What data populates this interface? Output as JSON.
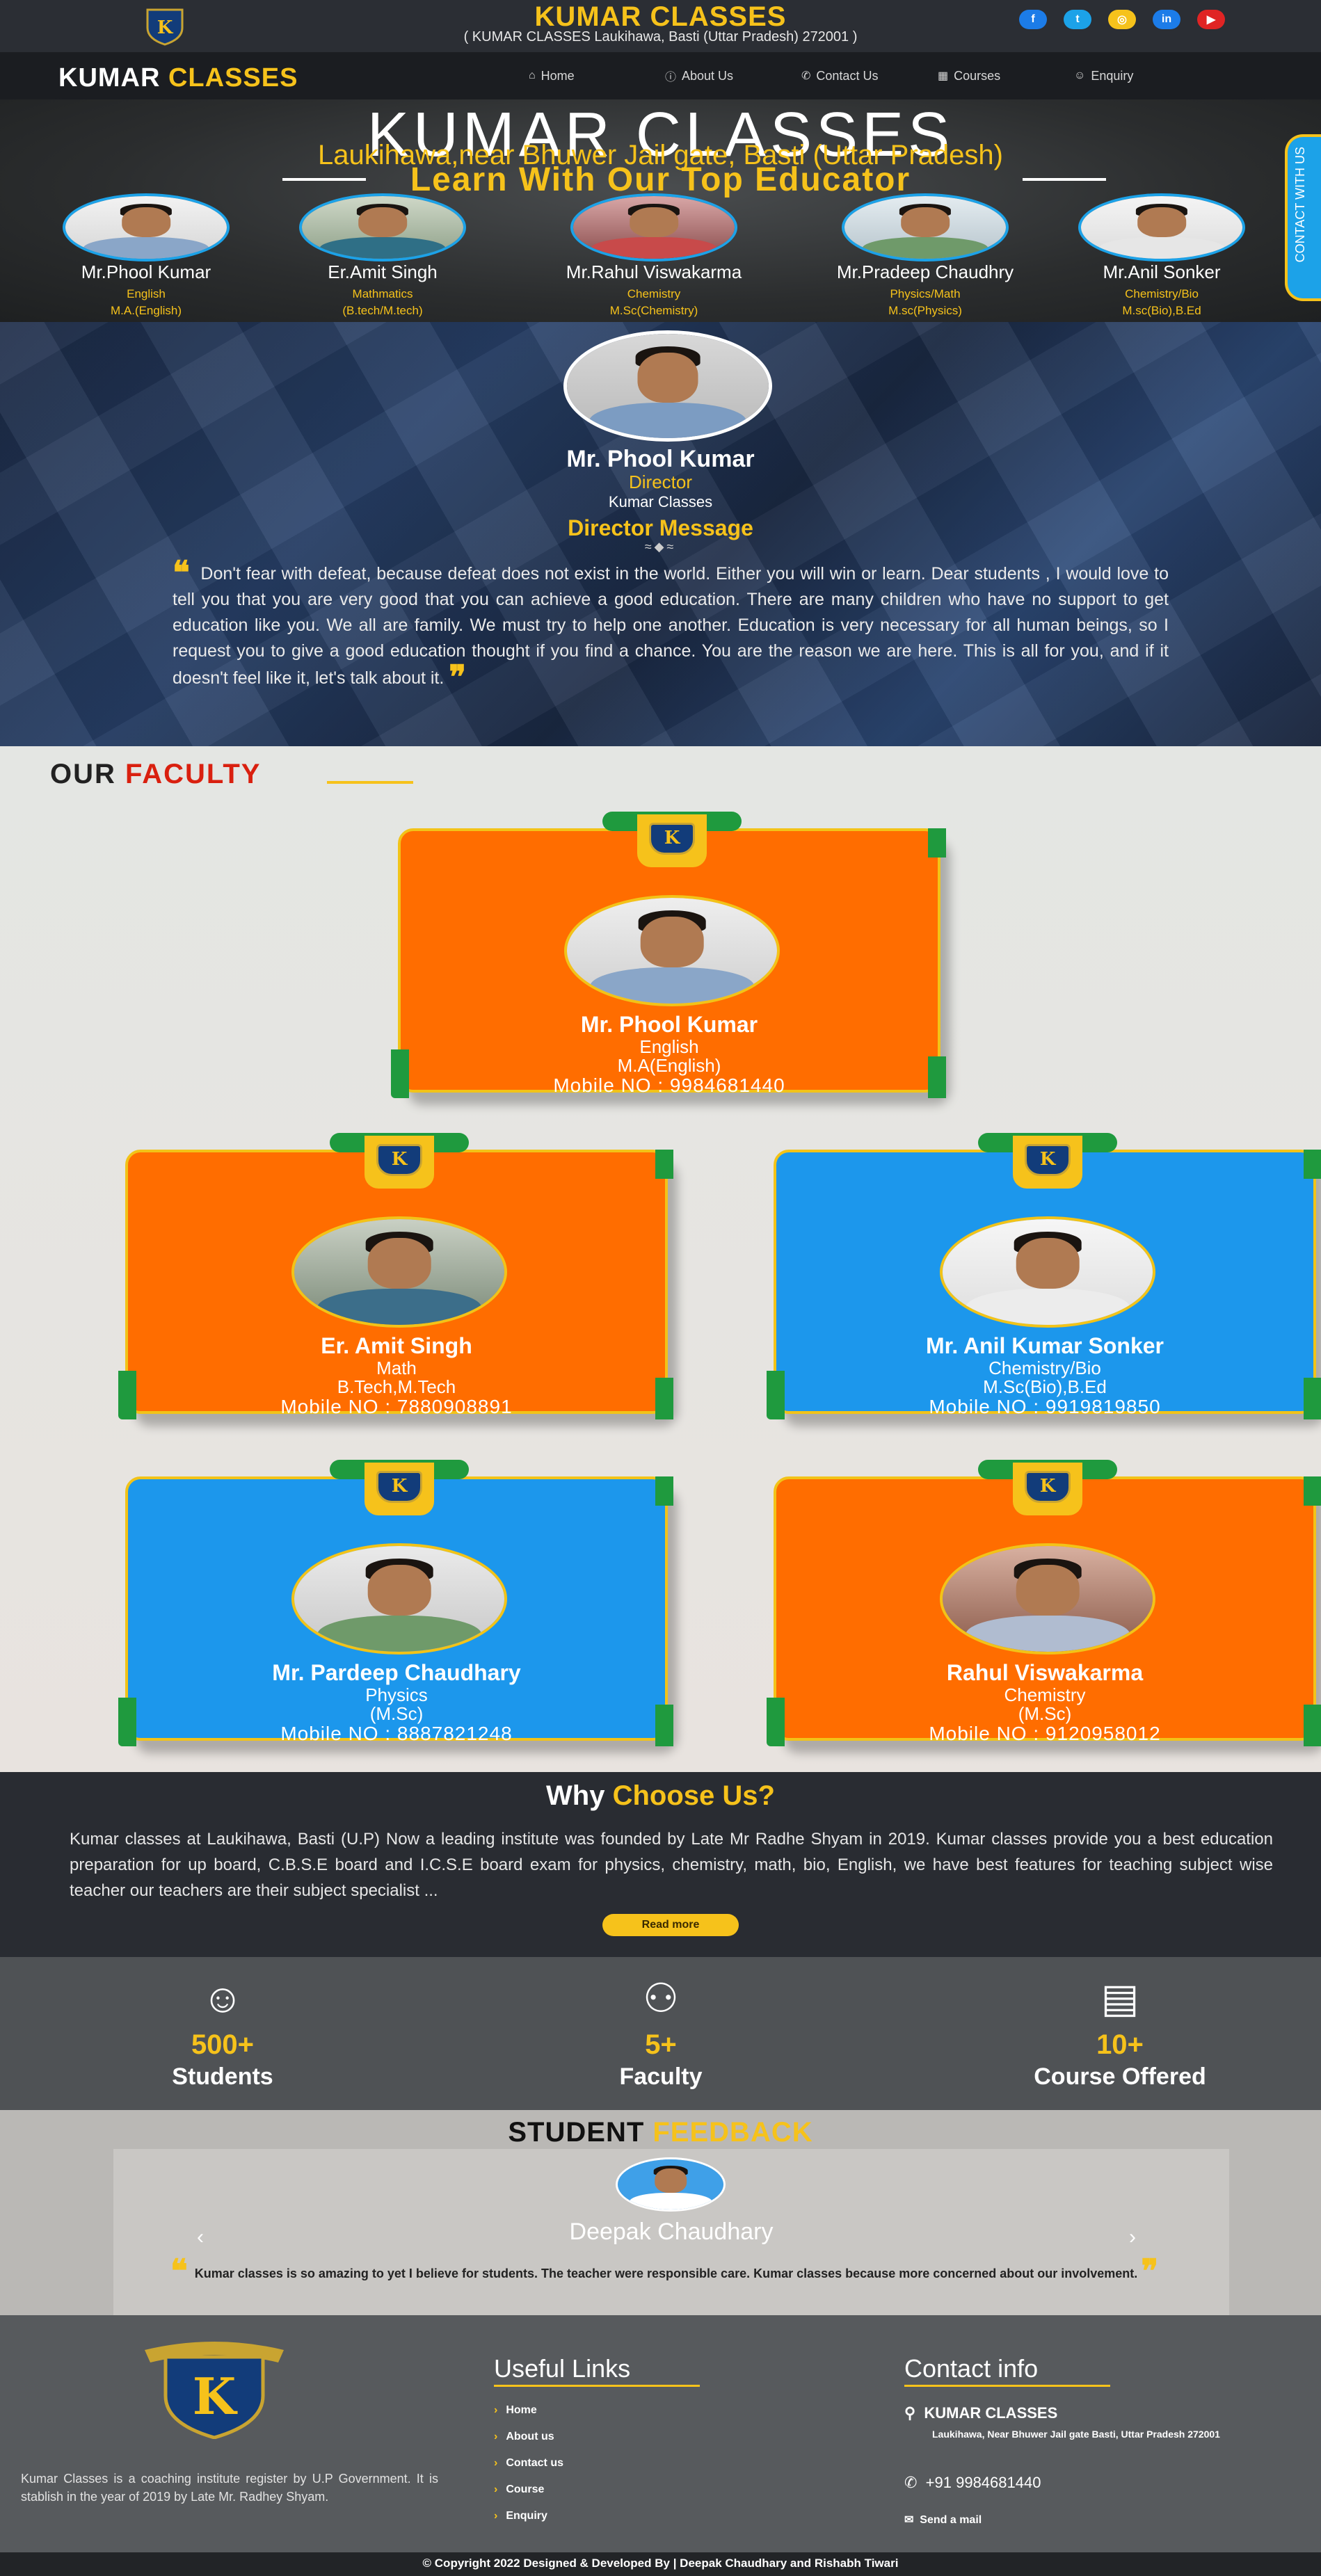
{
  "header": {
    "title": "KUMAR CLASSES",
    "subtitle": "( KUMAR CLASSES Laukihawa, Basti (Uttar Pradesh) 272001 )",
    "socials": [
      {
        "icon": "facebook-icon",
        "glyph": "f",
        "color": "#1c7ce8"
      },
      {
        "icon": "twitter-icon",
        "glyph": "t",
        "color": "#1ca2e8"
      },
      {
        "icon": "instagram-icon",
        "glyph": "◎",
        "color": "#f6c21b"
      },
      {
        "icon": "linkedin-icon",
        "glyph": "in",
        "color": "#1c7ce8"
      },
      {
        "icon": "youtube-icon",
        "glyph": "▶",
        "color": "#e02424"
      }
    ]
  },
  "nav": {
    "brand_a": "KUMAR ",
    "brand_b": "CLASSES",
    "items": [
      {
        "label": "Home",
        "icon": "home-icon",
        "glyph": "⌂"
      },
      {
        "label": "About Us",
        "icon": "info-icon",
        "glyph": "ⓘ"
      },
      {
        "label": "Contact Us",
        "icon": "phone-icon",
        "glyph": "✆"
      },
      {
        "label": "Courses",
        "icon": "book-icon",
        "glyph": "▦"
      },
      {
        "label": "Enquiry",
        "icon": "user-icon",
        "glyph": "☺"
      }
    ]
  },
  "hero": {
    "title": "KUMAR CLASSES",
    "location": "Laukihawa,near Bhuwer Jail gate, Basti (Uttar Pradesh)",
    "tagline": "Learn With Our Top Educator",
    "contact_tab": "CONTACT WITH US",
    "teachers": [
      {
        "name": "Mr.Phool Kumar",
        "subject": "English",
        "degree": "M.A.(English)"
      },
      {
        "name": "Er.Amit Singh",
        "subject": "Mathmatics",
        "degree": "(B.tech/M.tech)"
      },
      {
        "name": "Mr.Rahul Viswakarma",
        "subject": "Chemistry",
        "degree": "M.Sc(Chemistry)"
      },
      {
        "name": "Mr.Pradeep Chaudhry",
        "subject": "Physics/Math",
        "degree": "M.sc(Physics)"
      },
      {
        "name": "Mr.Anil Sonker",
        "subject": "Chemistry/Bio",
        "degree": "M.sc(Bio),B.Ed"
      }
    ]
  },
  "director": {
    "name": "Mr. Phool Kumar",
    "role": "Director",
    "org": "Kumar Classes",
    "message_title": "Director Message",
    "ornament": "≈◆≈",
    "quote": "Don't fear with defeat, because defeat does not exist in the world. Either you will win or learn. Dear students , I would love to tell you that you are very good that you can achieve a good education. There are many children who have no support to get education like you. We all are family. We must try to help one another. Education is very necessary for all human beings, so I request you to give a good education thought if you find a chance. You are the reason we are here. This is all for you, and if it doesn't feel like it, let's talk about it."
  },
  "faculty": {
    "heading_a": "OUR ",
    "heading_b": "FACULTY",
    "badge": "K",
    "members": [
      {
        "name": "Mr. Phool Kumar",
        "subject": "English",
        "degree": "M.A(English)",
        "mobile": "Mobile NO : 9984681440",
        "color": "#ff6d00"
      },
      {
        "name": "Er. Amit Singh",
        "subject": "Math",
        "degree": "B.Tech,M.Tech",
        "mobile": "Mobile NO : 7880908891",
        "color": "#ff6d00"
      },
      {
        "name": "Mr. Anil Kumar Sonker",
        "subject": "Chemistry/Bio",
        "degree": "M.Sc(Bio),B.Ed",
        "mobile": "Mobile NO : 9919819850",
        "color": "#1c97ec"
      },
      {
        "name": "Mr. Pardeep Chaudhary",
        "subject": "Physics",
        "degree": "(M.Sc)",
        "mobile": "Mobile NO : 8887821248",
        "color": "#1c97ec"
      },
      {
        "name": "Rahul Viswakarma",
        "subject": "Chemistry",
        "degree": "(M.Sc)",
        "mobile": "Mobile NO : 9120958012",
        "color": "#ff6d00"
      }
    ]
  },
  "why": {
    "title_a": "Why ",
    "title_b": "Choose Us?",
    "text": "Kumar classes at Laukihawa, Basti (U.P) Now a leading institute was founded by Late Mr Radhe Shyam in 2019. Kumar classes provide you a best education preparation for up board, C.B.S.E board and I.C.S.E board exam for physics, chemistry, math, bio, English, we have best features for teaching subject wise teacher our teachers are their subject specialist ...",
    "button": "Read more"
  },
  "stats": [
    {
      "number": "500+",
      "label": "Students",
      "icon": "students-icon"
    },
    {
      "number": "5+",
      "label": "Faculty",
      "icon": "faculty-icon"
    },
    {
      "number": "10+",
      "label": "Course Offered",
      "icon": "books-icon"
    }
  ],
  "feedback": {
    "title_a": "STUDENT ",
    "title_b": "FEEDBACK",
    "name": "Deepak Chaudhary",
    "text": "Kumar classes is so amazing to yet I believe for students. The teacher were responsible care. Kumar classes because more concerned about our involvement."
  },
  "footer": {
    "about": "Kumar Classes is a coaching institute register by U.P Government. It is stablish in the year of 2019 by Late Mr. Radhey Shyam.",
    "links_title": "Useful Links",
    "links": [
      "Home",
      "About us",
      "Contact us",
      "Course",
      "Enquiry"
    ],
    "contact_title": "Contact info",
    "contact_name": "KUMAR CLASSES",
    "address": "Laukihawa, Near Bhuwer Jail gate Basti, Uttar Pradesh 272001",
    "phone": "+91 9984681440",
    "email_label": "Send a mail",
    "copyright": "© Copyright 2022 Designed & Developed By | Deepak Chaudhary and Rishabh Tiwari"
  }
}
